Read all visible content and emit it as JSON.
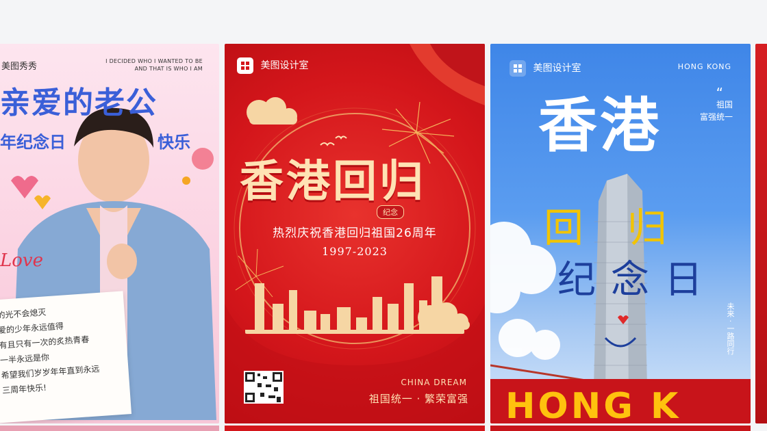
{
  "cards": [
    {
      "brand": "美图秀秀",
      "english_lines": [
        "I DECIDED WHO I WANTED TO BE",
        "AND THAT IS WHO I AM"
      ],
      "title": "亲爱的老公",
      "subtitle_left": "年纪念日",
      "subtitle_right": "快乐",
      "love_script": "Love",
      "note_lines": [
        "的光不会熄灭",
        "爱的少年永远值得",
        "有且只有一次的炙热青春",
        "一半永远是你",
        "希望我们岁岁年年直到永远",
        "三周年快乐!"
      ]
    },
    {
      "brand": "美图设计室",
      "big_title": "香港回归",
      "badge": "纪念",
      "headline": "热烈庆祝香港回归祖国26周年",
      "years": "1997-2023",
      "dream": "CHINA DREAM",
      "slogan": "祖国统一 · 繁荣富强"
    },
    {
      "brand": "美图设计室",
      "region": "HONG KONG",
      "quote_mark": "“",
      "side_text": "祖国\n富强统一",
      "hand_title": "香港",
      "hand_left": "回",
      "hand_right": "归",
      "hand_bottom": "纪念日",
      "vertical": "未来 · 一路同行",
      "banner": "HONG K"
    }
  ],
  "colors": {
    "card1_title": "#3a5fd8",
    "card2_bg": "#d4161b",
    "card2_gold": "#ffe2b4",
    "card3_sky": "#3f86e8",
    "hk_banner": "#c8141a"
  },
  "icons": [
    "meitu-logo-icon",
    "firework-icon",
    "cloud-icon",
    "heart-icon",
    "qr-code-icon",
    "skyline-icon"
  ]
}
